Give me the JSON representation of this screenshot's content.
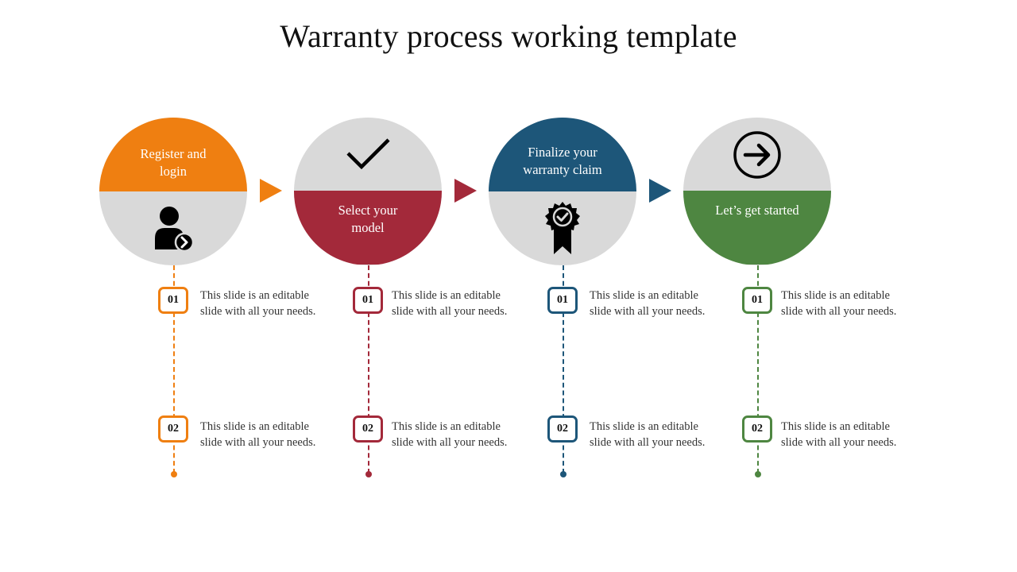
{
  "title": "Warranty process working template",
  "colors": {
    "orange": "#EF7F11",
    "red": "#A3293A",
    "blue": "#1D5679",
    "green": "#4E8641",
    "gray": "#D9D9D9"
  },
  "steps": [
    {
      "label": "Register and login",
      "label_line1": "Register and",
      "label_line2": "login",
      "icon": "user-arrow-icon",
      "color": "#EF7F11",
      "items": [
        {
          "number": "01",
          "text": "This slide is an editable slide with all your needs."
        },
        {
          "number": "02",
          "text": "This slide is an editable slide with all your needs."
        }
      ]
    },
    {
      "label": "Select your model",
      "label_line1": "Select your",
      "label_line2": "model",
      "icon": "checkmark-icon",
      "color": "#A3293A",
      "items": [
        {
          "number": "01",
          "text": "This slide is an editable slide with all your needs."
        },
        {
          "number": "02",
          "text": "This slide is an editable slide with all your needs."
        }
      ]
    },
    {
      "label": "Finalize your warranty claim",
      "label_line1": "Finalize your",
      "label_line2": "warranty claim",
      "icon": "award-badge-icon",
      "color": "#1D5679",
      "items": [
        {
          "number": "01",
          "text": "This slide is an editable slide with all your needs."
        },
        {
          "number": "02",
          "text": "This slide is an editable slide with all your needs."
        }
      ]
    },
    {
      "label": "Let’s get started",
      "label_line1": "Let’s get started",
      "label_line2": "",
      "icon": "arrow-circle-right-icon",
      "color": "#4E8641",
      "items": [
        {
          "number": "01",
          "text": "This slide is an editable slide with all your needs."
        },
        {
          "number": "02",
          "text": "This slide is an editable slide with all your needs."
        }
      ]
    }
  ]
}
